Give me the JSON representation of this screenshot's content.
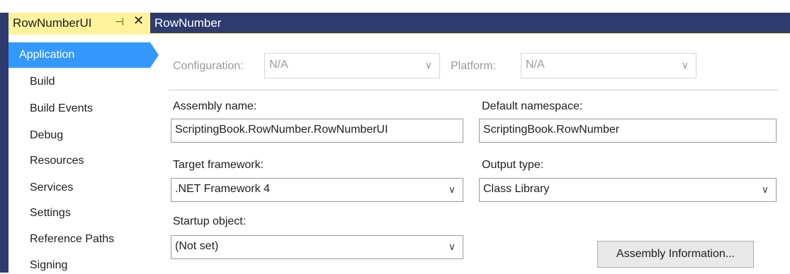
{
  "tabs": {
    "active": "RowNumberUI",
    "pin_glyph": "⊣",
    "close_glyph": "✕",
    "inactive": "RowNumber"
  },
  "sidebar": {
    "items": [
      {
        "label": "Application",
        "selected": true
      },
      {
        "label": "Build"
      },
      {
        "label": "Build Events"
      },
      {
        "label": "Debug"
      },
      {
        "label": "Resources"
      },
      {
        "label": "Services"
      },
      {
        "label": "Settings"
      },
      {
        "label": "Reference Paths"
      },
      {
        "label": "Signing"
      }
    ]
  },
  "config": {
    "configuration_label": "Configuration:",
    "configuration_value": "N/A",
    "platform_label": "Platform:",
    "platform_value": "N/A"
  },
  "form": {
    "assembly_name_label": "Assembly name:",
    "assembly_name_value": "ScriptingBook.RowNumber.RowNumberUI",
    "default_namespace_label": "Default namespace:",
    "default_namespace_value": "ScriptingBook.RowNumber",
    "target_framework_label": "Target framework:",
    "target_framework_value": ".NET Framework 4",
    "output_type_label": "Output type:",
    "output_type_value": "Class Library",
    "startup_object_label": "Startup object:",
    "startup_object_value": "(Not set)",
    "assembly_info_button": "Assembly Information..."
  },
  "colors": {
    "tab_bar": "#2d3b6e",
    "active_tab": "#fff29d",
    "selection": "#3399ff"
  }
}
